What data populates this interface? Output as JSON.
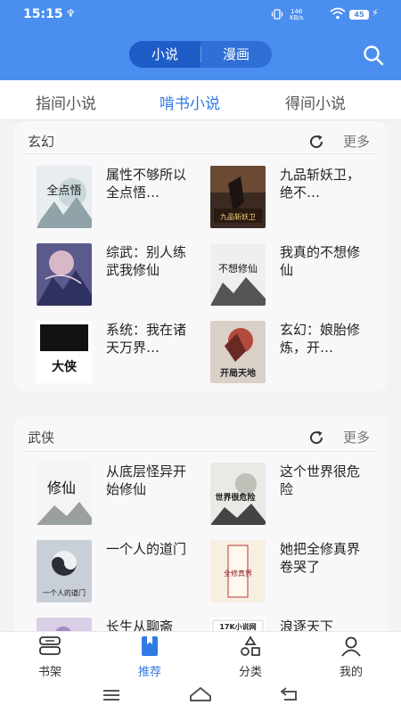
{
  "status_bar": {
    "time": "15:15",
    "usb_glyph": "♆",
    "net_speed_value": "146",
    "net_speed_unit": "KB/s",
    "battery": "45",
    "charging_glyph": "⚡"
  },
  "header": {
    "segments": [
      {
        "label": "小说",
        "selected": true
      },
      {
        "label": "漫画",
        "selected": false
      }
    ],
    "accent_color": "#4a8ef0"
  },
  "tabs": [
    {
      "label": "指间小说",
      "active": false
    },
    {
      "label": "啃书小说",
      "active": true
    },
    {
      "label": "得间小说",
      "active": false
    }
  ],
  "sections": [
    {
      "title": "玄幻",
      "more_label": "更多",
      "books": [
        {
          "title": "属性不够所以全点悟…",
          "cover_text": "全点悟"
        },
        {
          "title": "九品斩妖卫，绝不…",
          "cover_text": "九品斩妖卫"
        },
        {
          "title": "综武：别人练武我修仙",
          "cover_text": ""
        },
        {
          "title": "我真的不想修仙",
          "cover_text": "不想修仙"
        },
        {
          "title": "系统：我在诸天万界…",
          "cover_text": "大侠"
        },
        {
          "title": "玄幻：娘胎修炼，开…",
          "cover_text": "开局天地"
        }
      ]
    },
    {
      "title": "武侠",
      "more_label": "更多",
      "books": [
        {
          "title": "从底层怪异开始修仙",
          "cover_text": "修仙"
        },
        {
          "title": "这个世界很危险",
          "cover_text": "世界很危险"
        },
        {
          "title": "一个人的道门",
          "cover_text": "一个人的道门"
        },
        {
          "title": "她把全修真界卷哭了",
          "cover_text": "全修真界"
        },
        {
          "title": "长生从聊斋",
          "cover_text": ""
        },
        {
          "title": "浪逐天下",
          "cover_text": "17K小说网"
        }
      ]
    }
  ],
  "bottom_nav": [
    {
      "label": "书架",
      "icon": "bookshelf-icon",
      "active": false
    },
    {
      "label": "推荐",
      "icon": "recommend-icon",
      "active": true
    },
    {
      "label": "分类",
      "icon": "category-icon",
      "active": false
    },
    {
      "label": "我的",
      "icon": "profile-icon",
      "active": false
    }
  ],
  "colors": {
    "primary": "#4a8ef0",
    "active_tab": "#2f7ae5",
    "background": "#f2f3f5"
  }
}
